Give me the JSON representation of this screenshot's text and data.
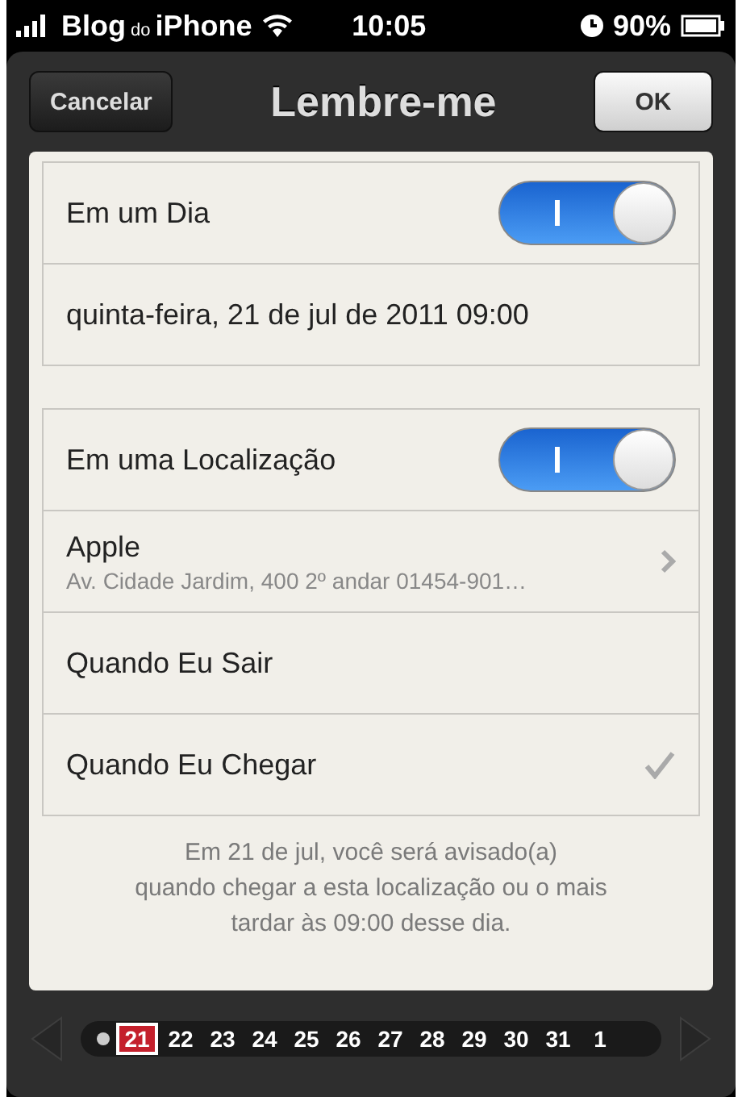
{
  "status_bar": {
    "carrier_parts": [
      "Blog",
      "do",
      "iPhone"
    ],
    "time": "10:05",
    "battery": "90%"
  },
  "nav": {
    "title": "Lembre-me",
    "left_button": "Cancelar",
    "right_button": "OK"
  },
  "groups": [
    {
      "rows": [
        {
          "kind": "toggle",
          "label": "Em um Dia",
          "on": true
        },
        {
          "kind": "value",
          "label": "quinta-feira, 21 de jul de 2011 09:00"
        }
      ]
    },
    {
      "rows": [
        {
          "kind": "toggle",
          "label": "Em uma Localização",
          "on": true
        },
        {
          "kind": "detail",
          "label": "Apple",
          "subtitle": "Av. Cidade Jardim, 400 2º andar 01454-901…"
        },
        {
          "kind": "option",
          "label": "Quando Eu Sair",
          "selected": false
        },
        {
          "kind": "option",
          "label": "Quando Eu Chegar",
          "selected": true
        }
      ]
    }
  ],
  "footer": "Em 21 de jul, você será avisado(a)\nquando chegar a esta localização ou o mais\ntardar às 09:00 desse dia.",
  "date_strip": {
    "days": [
      {
        "label": "21",
        "selected": true
      },
      {
        "label": "22",
        "selected": false
      },
      {
        "label": "23",
        "selected": false
      },
      {
        "label": "24",
        "selected": false
      },
      {
        "label": "25",
        "selected": false
      },
      {
        "label": "26",
        "selected": false
      },
      {
        "label": "27",
        "selected": false
      },
      {
        "label": "28",
        "selected": false
      },
      {
        "label": "29",
        "selected": false
      },
      {
        "label": "30",
        "selected": false
      },
      {
        "label": "31",
        "selected": false
      },
      {
        "label": "1",
        "selected": false
      }
    ]
  }
}
